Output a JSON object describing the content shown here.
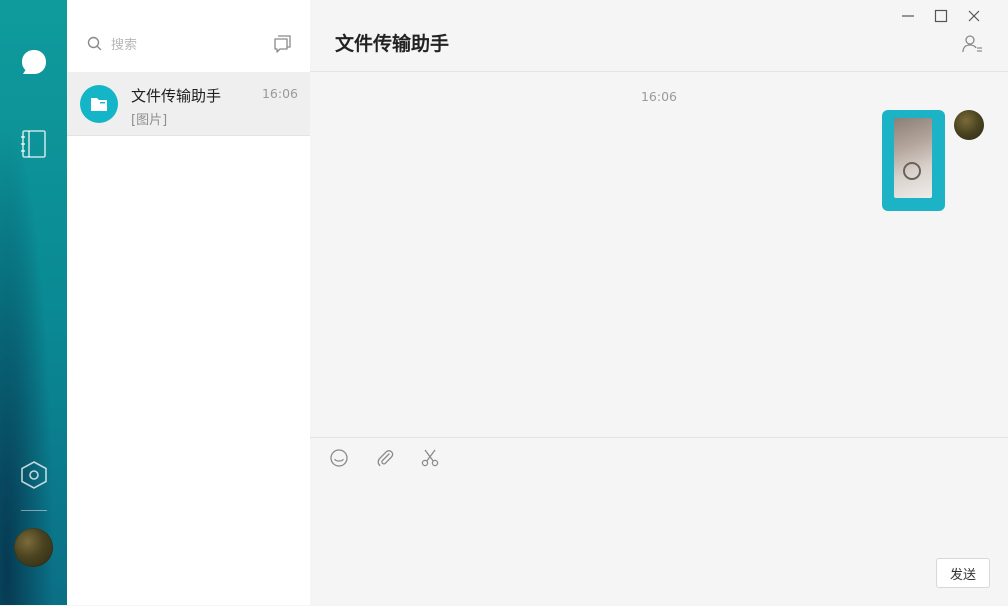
{
  "search": {
    "placeholder": "搜索"
  },
  "conversations": [
    {
      "name": "文件传输助手",
      "time": "16:06",
      "preview": "[图片]"
    }
  ],
  "chat": {
    "title": "文件传输助手",
    "timestamp": "16:06",
    "messages": [
      {
        "type": "image",
        "sender": "me"
      }
    ]
  },
  "composer": {
    "send_label": "发送"
  },
  "colors": {
    "accent": "#1bb3c5",
    "rail_top": "#0f9b9c",
    "rail_bottom": "#0b6f86"
  }
}
